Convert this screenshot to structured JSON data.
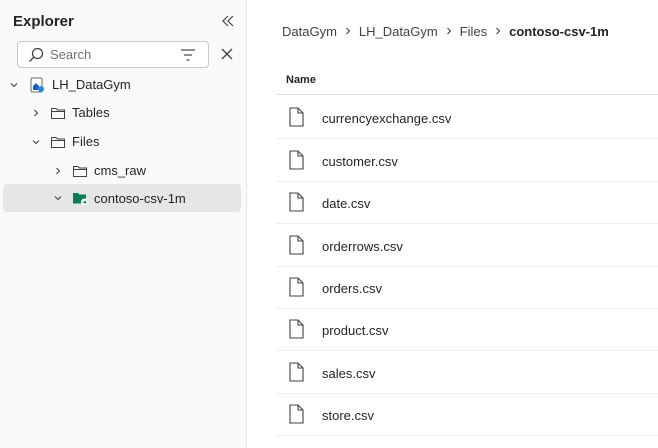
{
  "explorer": {
    "title": "Explorer",
    "search_placeholder": "Search"
  },
  "tree": [
    {
      "label": "LH_DataGym",
      "icon": "lakehouse-icon",
      "level": 0,
      "expanded": true
    },
    {
      "label": "Tables",
      "icon": "folder-icon",
      "level": 1,
      "expanded": false
    },
    {
      "label": "Files",
      "icon": "folder-icon",
      "level": 1,
      "expanded": true
    },
    {
      "label": "cms_raw",
      "icon": "folder-icon",
      "level": 2,
      "expanded": false
    },
    {
      "label": "contoso-csv-1m",
      "icon": "shortcut-folder-icon",
      "level": 2,
      "expanded": true,
      "selected": true
    }
  ],
  "breadcrumb": [
    "DataGym",
    "LH_DataGym",
    "Files",
    "contoso-csv-1m"
  ],
  "table": {
    "column_name": "Name",
    "files": [
      "currencyexchange.csv",
      "customer.csv",
      "date.csv",
      "orderrows.csv",
      "orders.csv",
      "product.csv",
      "sales.csv",
      "store.csv"
    ]
  },
  "colors": {
    "selected_bg": "#e6e6e6",
    "shortcut_green": "#0e7a59",
    "lakehouse_blue": "#1f5fbf"
  }
}
